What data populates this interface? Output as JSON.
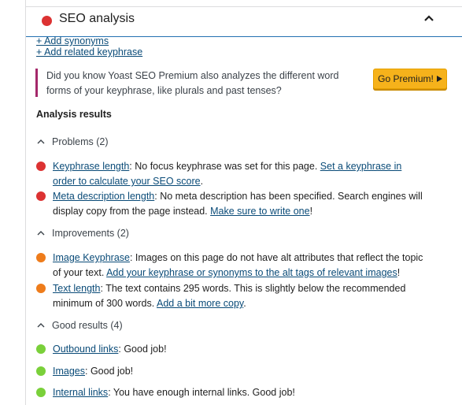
{
  "header": {
    "title": "SEO analysis",
    "status_color": "#dc3232",
    "chevron": "chevron-up-icon"
  },
  "links": {
    "add_synonyms": "+ Add synonyms",
    "add_related": "+ Add related keyphrase"
  },
  "upsell": {
    "text": "Did you know Yoast SEO Premium also analyzes the different word forms of your keyphrase, like plurals and past tenses?",
    "button": "Go Premium!",
    "button_icon": "triangle-right-icon",
    "accent": "#a4286a",
    "button_color": "#f6b21b"
  },
  "results_title": "Analysis results",
  "groups": {
    "problems": {
      "label": "Problems (2)",
      "items": [
        {
          "link": "Keyphrase length",
          "text": ": No focus keyphrase was set for this page. ",
          "action": "Set a keyphrase in order to calculate your SEO score",
          "tail": "."
        },
        {
          "link": "Meta description length",
          "text": ": No meta description has been specified. Search engines will display copy from the page instead. ",
          "action": "Make sure to write one",
          "tail": "!"
        }
      ]
    },
    "improvements": {
      "label": "Improvements (2)",
      "items": [
        {
          "link": "Image Keyphrase",
          "text": ": Images on this page do not have alt attributes that reflect the topic of your text. ",
          "action": "Add your keyphrase or synonyms to the alt tags of relevant images",
          "tail": "!"
        },
        {
          "link": "Text length",
          "text": ": The text contains 295 words. This is slightly below the recommended minimum of 300 words. ",
          "action": "Add a bit more copy",
          "tail": "."
        }
      ]
    },
    "good": {
      "label": "Good results (4)",
      "items": [
        {
          "link": "Outbound links",
          "text": ": Good job!"
        },
        {
          "link": "Images",
          "text": ": Good job!"
        },
        {
          "link": "Internal links",
          "text": ": You have enough internal links. Good job!"
        }
      ]
    }
  },
  "colors": {
    "problem": "#dc3232",
    "improvement": "#ee7c1b",
    "good": "#7ad03a",
    "link": "#0a4b78"
  }
}
